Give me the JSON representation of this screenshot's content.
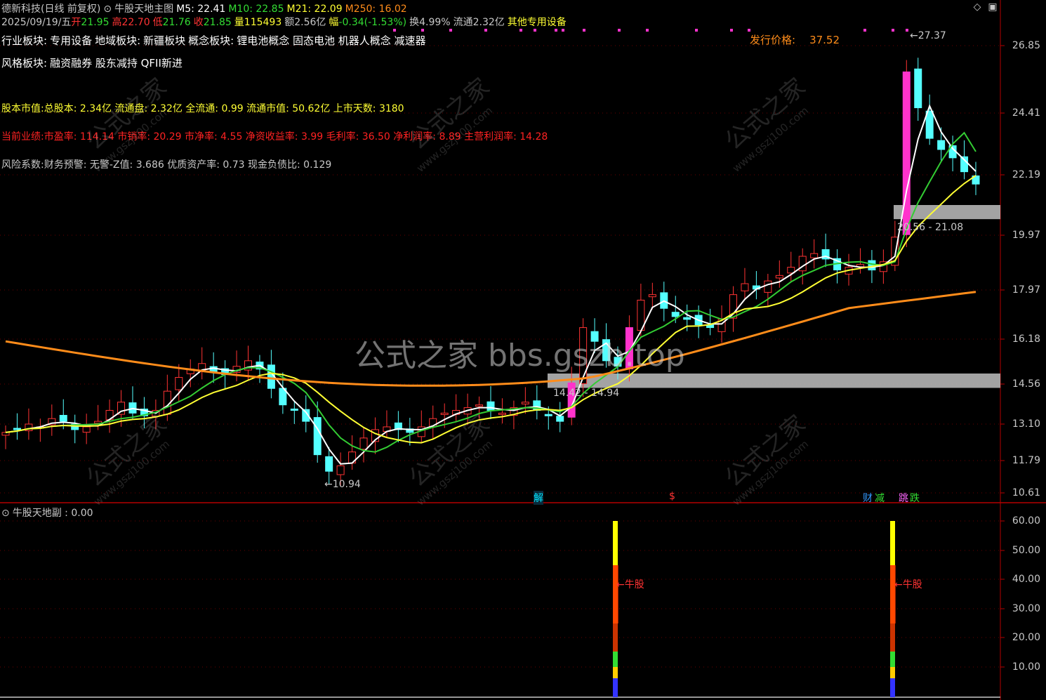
{
  "header": {
    "stock_name": "德新科技(日线 前复权)",
    "indicator_name": "牛股天地主图",
    "ma5": "M5: 22.41",
    "ma10": "M10: 22.85",
    "ma21": "M21: 22.09",
    "ma250": "M250: 16.02"
  },
  "quote": {
    "date": "2025/09/19/五",
    "open_label": "开",
    "open": "21.95",
    "high_label": "高",
    "high": "22.70",
    "low_label": "低",
    "low": "21.76",
    "close_label": "收",
    "close": "21.85",
    "vol_label": "量",
    "vol": "115493",
    "amt_label": "额",
    "amt": "2.56亿",
    "chg_label": "幅",
    "chg": "-0.34(-1.53%)",
    "turn_label": "换",
    "turn": "4.99%",
    "float_label": "流通",
    "float": "2.32亿",
    "industry": "其他专用设备"
  },
  "info": {
    "sector_label": "行业板块:",
    "sector": "专用设备",
    "region_label": "地域板块:",
    "region": "新疆板块",
    "concept_label": "概念板块:",
    "concept": "锂电池概念 固态电池 机器人概念 减速器",
    "style_label": "风格板块:",
    "style": "融资融券 股东减持 QFII新进",
    "issue_label": "发行价格:",
    "issue_price": "37.52",
    "capital_label": "股本市值:",
    "capital_text": "总股本: 2.34亿 流通盘: 2.32亿 全流通: 0.99 流通市值: 50.62亿 上市天数: 3180",
    "perf_label": "当前业绩:",
    "perf_text": "市盈率: 114.14 市销率: 20.29 市净率: 4.55 净资收益率: 3.99 毛利率: 36.50 净利润率: 8.89 主营利润率: 14.28",
    "risk_label": "风险系数:",
    "risk_text": "财务预警: 无警-Z值: 3.686 优质资产率: 0.73 现金负债比: 0.129"
  },
  "annotations": {
    "peak": "27.37",
    "trough": "10.94",
    "zone_upper": "20.56 - 21.08",
    "zone_lower": "14.42 - 14.94",
    "marker_jie": "解",
    "marker_s": "$",
    "marker_cai": "财",
    "marker_jian": "减",
    "marker_tiao": "跳",
    "marker_die": "跌"
  },
  "y_axis_main": [
    "26.85",
    "24.41",
    "22.19",
    "19.97",
    "17.97",
    "16.18",
    "14.56",
    "13.10",
    "11.79",
    "10.61"
  ],
  "sub": {
    "title": "牛股天地副 : 0.00",
    "signal_label": "牛股",
    "y_axis": [
      "60.00",
      "50.00",
      "40.00",
      "30.00",
      "20.00",
      "10.00"
    ]
  },
  "watermark": {
    "center": "公式之家 bbs.gszb.top",
    "tile": "公式之家",
    "tile_sub": "www.gszj100.com"
  },
  "colors": {
    "bg": "#000000",
    "up": "#ff3333",
    "down": "#54ffff",
    "ma5": "#ffffff",
    "ma10": "#33cc33",
    "ma21": "#ffff33",
    "ma250": "#ff8c1a",
    "zone": "#c0c0c0",
    "magenta": "#ff33cc",
    "axis": "#b40000"
  },
  "chart_data": {
    "type": "candlestick",
    "ma_series": [
      {
        "name": "M5",
        "last": 22.41
      },
      {
        "name": "M10",
        "last": 22.85
      },
      {
        "name": "M21",
        "last": 22.09
      },
      {
        "name": "M250",
        "last": 16.02
      }
    ],
    "y_ticks": [
      26.85,
      24.41,
      22.19,
      19.97,
      17.97,
      16.18,
      14.56,
      13.1,
      11.79,
      10.61
    ],
    "sub_y_ticks": [
      60,
      50,
      40,
      30,
      20,
      10
    ],
    "high_mark": 27.37,
    "low_mark": 10.94,
    "zones": [
      [
        20.56,
        21.08
      ],
      [
        14.42,
        14.94
      ]
    ],
    "close_path": [
      12.8,
      12.9,
      13.1,
      13.0,
      13.3,
      13.2,
      12.9,
      13.0,
      13.2,
      13.6,
      13.9,
      13.5,
      13.4,
      13.6,
      14.3,
      14.8,
      15.1,
      15.3,
      15.0,
      14.9,
      15.2,
      15.4,
      15.1,
      14.4,
      13.8,
      13.6,
      13.2,
      12.0,
      11.4,
      11.6,
      12.1,
      12.6,
      12.9,
      13.0,
      12.9,
      12.8,
      13.0,
      13.3,
      13.5,
      13.6,
      13.7,
      13.8,
      13.6,
      13.5,
      13.7,
      13.9,
      13.6,
      13.4,
      13.2,
      14.6,
      16.6,
      16.1,
      15.4,
      15.2,
      16.6,
      17.6,
      17.8,
      17.3,
      17.0,
      16.9,
      16.7,
      16.6,
      16.9,
      17.8,
      18.2,
      18.0,
      18.3,
      18.5,
      18.8,
      19.2,
      19.3,
      19.1,
      18.7,
      18.8,
      18.9,
      18.7,
      19.0,
      19.9,
      25.9,
      24.6,
      23.5,
      23.1,
      22.8,
      22.3,
      21.85
    ],
    "signals": [
      {
        "index": 54,
        "value": 60,
        "label": "牛股"
      },
      {
        "index": 79,
        "value": 60,
        "label": "牛股"
      }
    ]
  }
}
